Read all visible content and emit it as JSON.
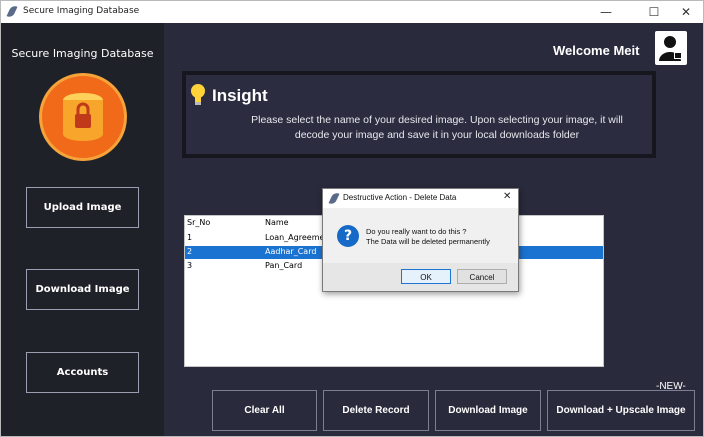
{
  "window": {
    "title": "Secure Imaging Database",
    "min": "—",
    "max": "☐",
    "close": "✕"
  },
  "sidebar": {
    "title": "Secure Imaging Database",
    "buttons": [
      "Upload Image",
      "Download Image",
      "Accounts"
    ]
  },
  "header": {
    "welcome": "Welcome Meit"
  },
  "insight": {
    "title": "Insight",
    "text": "Please select the name of your desired image. Upon selecting your image, it will decode your image and save it in your local downloads folder"
  },
  "table": {
    "columns": [
      "Sr_No",
      "Name"
    ],
    "rows": [
      {
        "sr": "1",
        "name": "Loan_Agreement"
      },
      {
        "sr": "2",
        "name": "Aadhar_Card",
        "selected": true
      },
      {
        "sr": "3",
        "name": "Pan_Card"
      }
    ]
  },
  "actions": {
    "clear_all": "Clear All",
    "delete_record": "Delete Record",
    "download_image": "Download Image",
    "download_upscale": "Download + Upscale Image",
    "new_tag": "-NEW-"
  },
  "dialog": {
    "title": "Destructive Action - Delete Data",
    "close": "✕",
    "line1": "Do you really want to do this ?",
    "line2": "The Data will be deleted permanently",
    "ok": "OK",
    "cancel": "Cancel",
    "icon_glyph": "?"
  },
  "colors": {
    "accent": "#1a73d1",
    "logo": "#f06a1a"
  },
  "icons": {
    "insight": "lightbulb-icon",
    "avatar": "user-lock-icon",
    "logo": "database-lock-icon"
  }
}
